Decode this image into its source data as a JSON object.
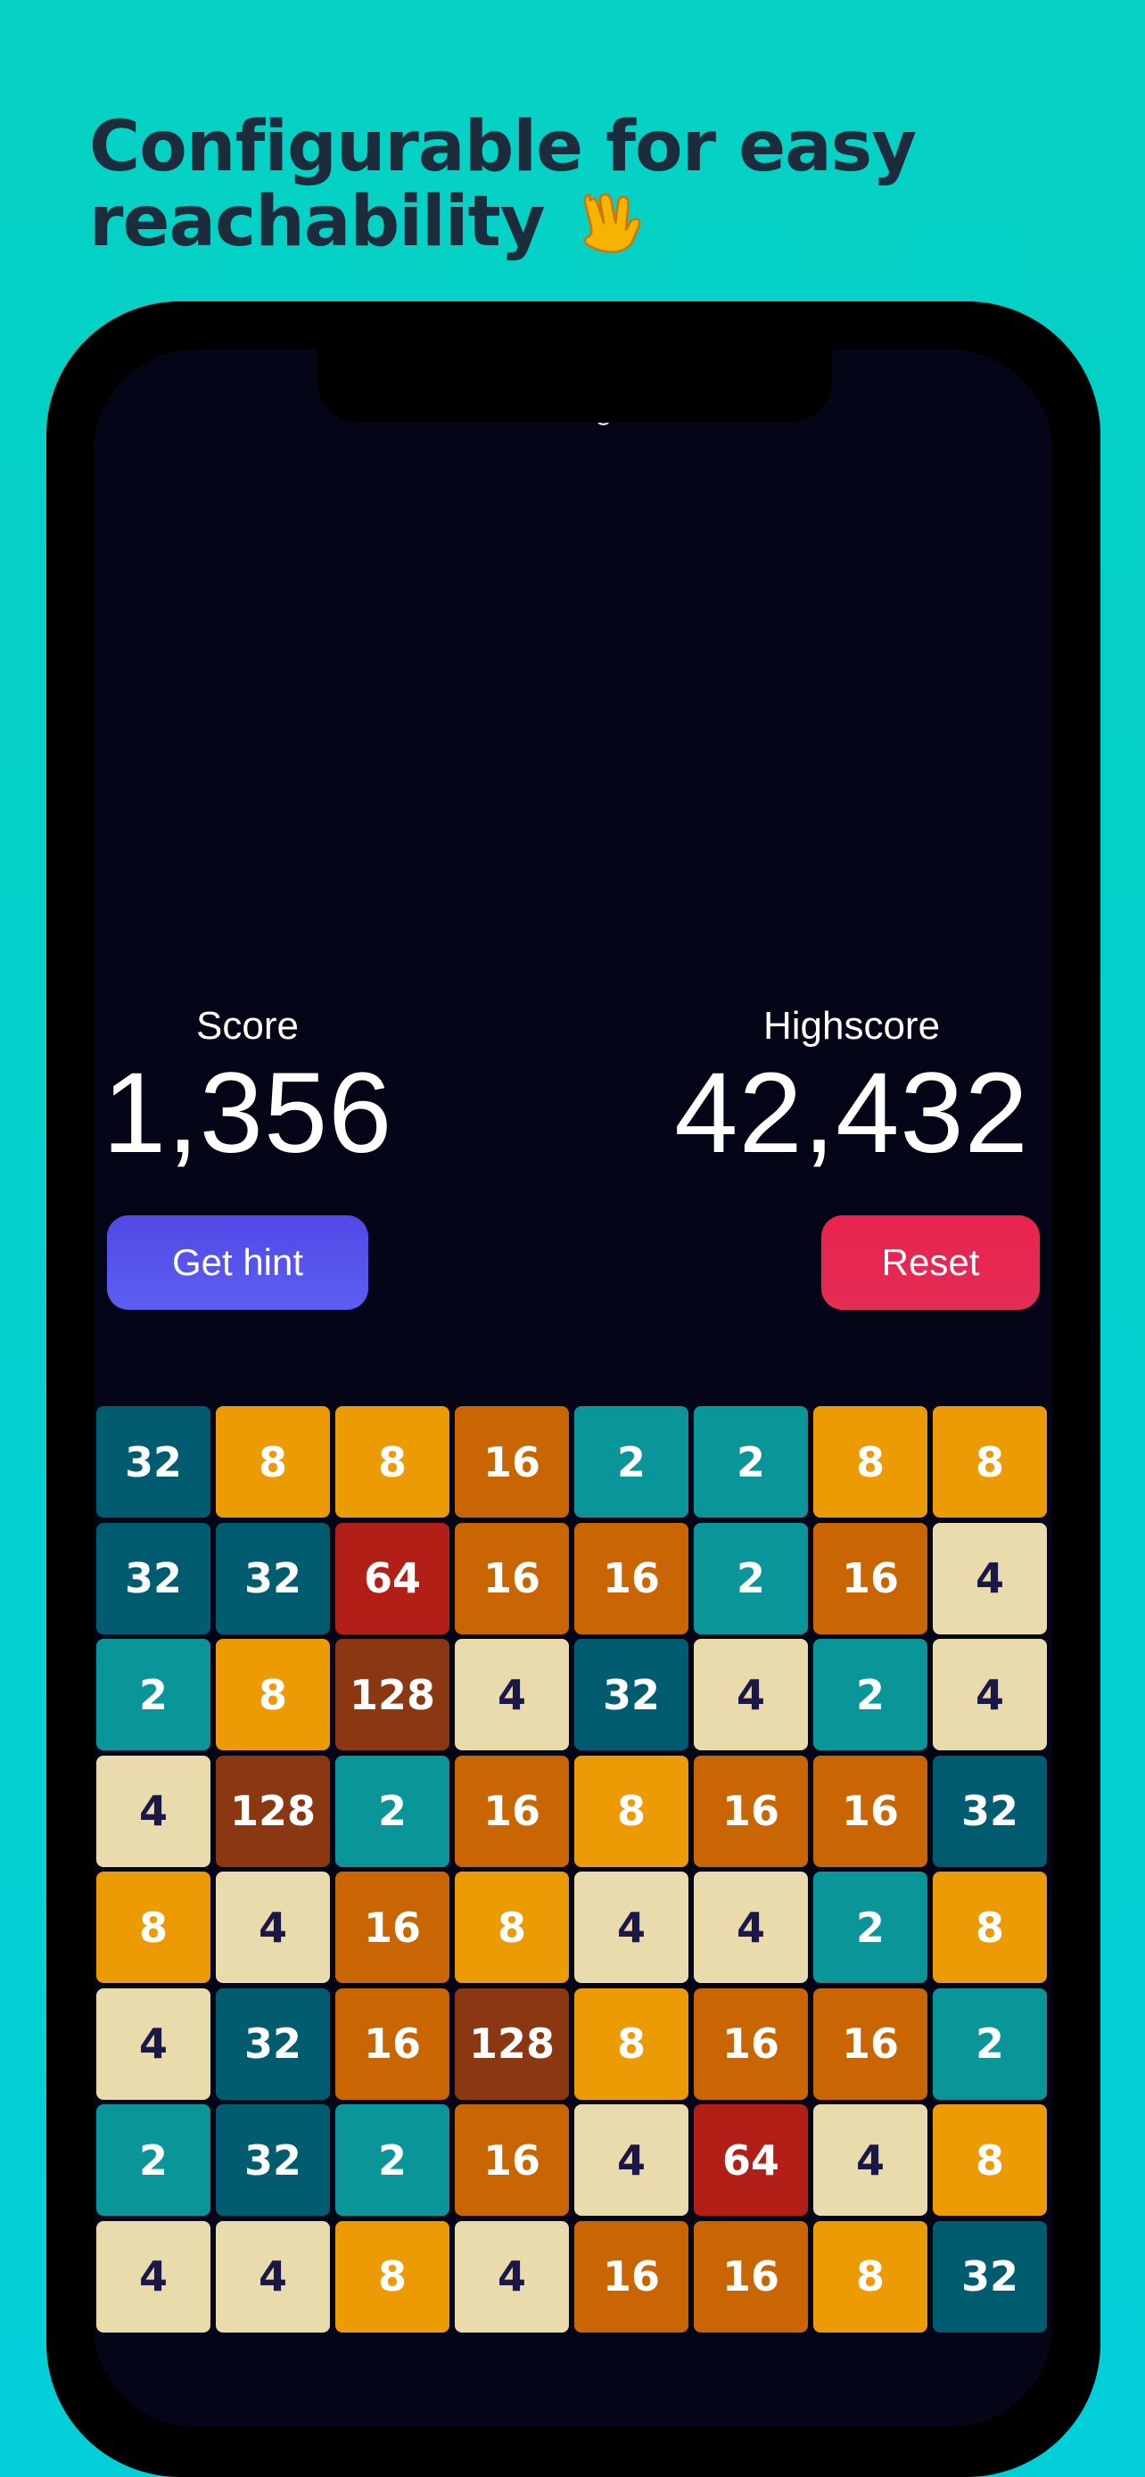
{
  "headline": {
    "line1": "Configurable for easy",
    "line2": "reachability",
    "emoji_icon": "vulcan-salute-icon"
  },
  "app": {
    "settings_label": "Settings",
    "score": {
      "label": "Score",
      "value": "1,356"
    },
    "highscore": {
      "label": "Highscore",
      "value": "42,432"
    },
    "buttons": {
      "hint": "Get hint",
      "reset": "Reset"
    }
  },
  "board": [
    [
      32,
      8,
      8,
      16,
      2,
      2,
      8,
      8
    ],
    [
      32,
      32,
      64,
      16,
      16,
      2,
      16,
      4
    ],
    [
      2,
      8,
      128,
      4,
      32,
      4,
      2,
      4
    ],
    [
      4,
      128,
      2,
      16,
      8,
      16,
      16,
      32
    ],
    [
      8,
      4,
      16,
      8,
      4,
      4,
      2,
      8
    ],
    [
      4,
      32,
      16,
      128,
      8,
      16,
      16,
      2
    ],
    [
      2,
      32,
      2,
      16,
      4,
      64,
      4,
      8
    ],
    [
      4,
      4,
      8,
      4,
      16,
      16,
      8,
      32
    ]
  ],
  "tile_colors": {
    "2": {
      "bg": "#0a9699",
      "fg": "#ffffff"
    },
    "4": {
      "bg": "#eadbac",
      "fg": "#1b1848"
    },
    "8": {
      "bg": "#ed9b04",
      "fg": "#ffffff"
    },
    "16": {
      "bg": "#c96503",
      "fg": "#ffffff"
    },
    "32": {
      "bg": "#015c70",
      "fg": "#ffffff"
    },
    "64": {
      "bg": "#b11f16",
      "fg": "#ffffff"
    },
    "128": {
      "bg": "#8a3712",
      "fg": "#ffffff"
    }
  },
  "colors": {
    "background": "#05d1c3",
    "screen": "#040617",
    "headline": "#1d2c3c"
  }
}
